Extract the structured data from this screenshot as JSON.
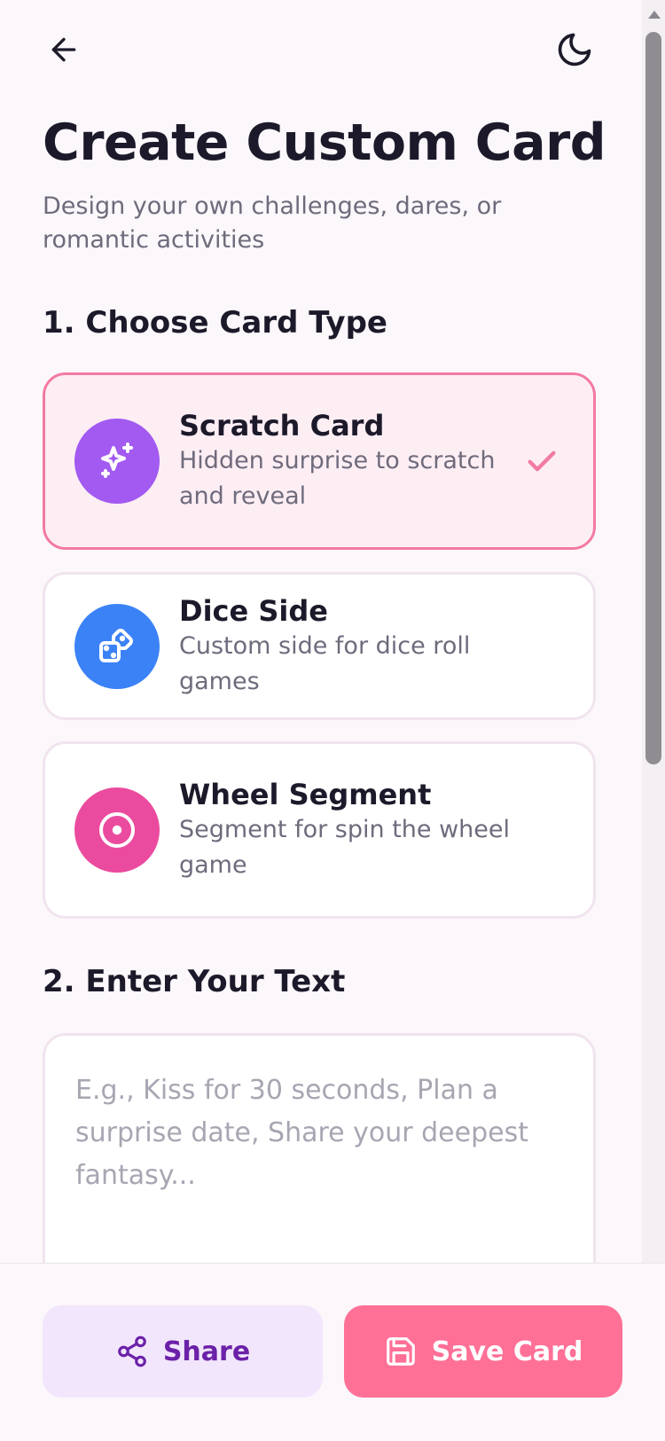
{
  "header": {
    "back_icon": "arrow-left-icon",
    "theme_icon": "moon-icon"
  },
  "page": {
    "title": "Create Custom Card",
    "subtitle": "Design your own challenges, dares, or romantic activities"
  },
  "section1": {
    "heading": "1. Choose Card Type",
    "selected": "scratch",
    "options": [
      {
        "id": "scratch",
        "title": "Scratch Card",
        "description": "Hidden surprise to scratch and reveal",
        "icon": "sparkles-icon",
        "color": "#a25af1"
      },
      {
        "id": "dice",
        "title": "Dice Side",
        "description": "Custom side for dice roll games",
        "icon": "dice-icon",
        "color": "#3b82f6"
      },
      {
        "id": "wheel",
        "title": "Wheel Segment",
        "description": "Segment for spin the wheel game",
        "icon": "target-circle-icon",
        "color": "#eb4b9e"
      }
    ]
  },
  "section2": {
    "heading": "2. Enter Your Text",
    "placeholder": "E.g., Kiss for 30 seconds, Plan a surprise date, Share your deepest fantasy...",
    "value": ""
  },
  "actions": {
    "share_label": "Share",
    "save_label": "Save Card"
  },
  "colors": {
    "selected_border": "#f27aa3",
    "selected_bg": "#fdeef4",
    "save_button": "#ff7097",
    "share_button_bg": "#f2e6fc",
    "share_button_text": "#6b21a8"
  }
}
